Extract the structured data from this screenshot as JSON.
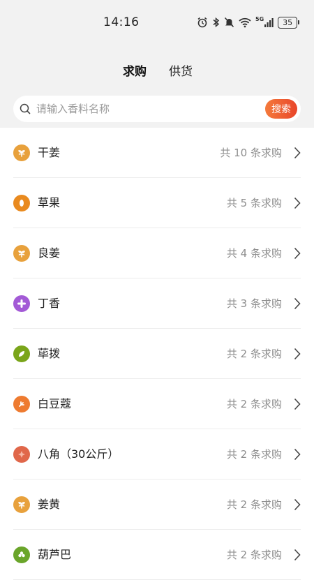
{
  "status_bar": {
    "time": "14:16",
    "network": "5G",
    "battery": "35",
    "icons": [
      "alarm-icon",
      "bluetooth-icon",
      "mute-icon",
      "wifi-icon",
      "signal-icon",
      "battery-icon"
    ]
  },
  "tabs": [
    {
      "label": "求购",
      "active": true
    },
    {
      "label": "供货",
      "active": false
    }
  ],
  "search": {
    "placeholder": "请输入香料名称",
    "value": "",
    "button_label": "搜索",
    "button_colors": [
      "#f47a3c",
      "#e9462a"
    ]
  },
  "list": [
    {
      "name": "干姜",
      "count": "共 10 条求购",
      "icon": "ginger-icon",
      "color": "#e8a13c"
    },
    {
      "name": "草果",
      "count": "共 5 条求购",
      "icon": "tsaoko-icon",
      "color": "#e98a1f"
    },
    {
      "name": "良姜",
      "count": "共 4 条求购",
      "icon": "galangal-icon",
      "color": "#e8a13c"
    },
    {
      "name": "丁香",
      "count": "共 3 条求购",
      "icon": "clove-icon",
      "color": "#a35ad6"
    },
    {
      "name": "荜拨",
      "count": "共 2 条求购",
      "icon": "long-pepper-icon",
      "color": "#7aa51a"
    },
    {
      "name": "白豆蔻",
      "count": "共 2 条求购",
      "icon": "cardamom-icon",
      "color": "#ee7b30"
    },
    {
      "name": "八角（30公斤）",
      "count": "共 2 条求购",
      "icon": "star-anise-icon",
      "color": "#e0674a"
    },
    {
      "name": "姜黄",
      "count": "共 2 条求购",
      "icon": "turmeric-icon",
      "color": "#e8a13c"
    },
    {
      "name": "葫芦巴",
      "count": "共 2 条求购",
      "icon": "fenugreek-icon",
      "color": "#6aa52a"
    }
  ]
}
